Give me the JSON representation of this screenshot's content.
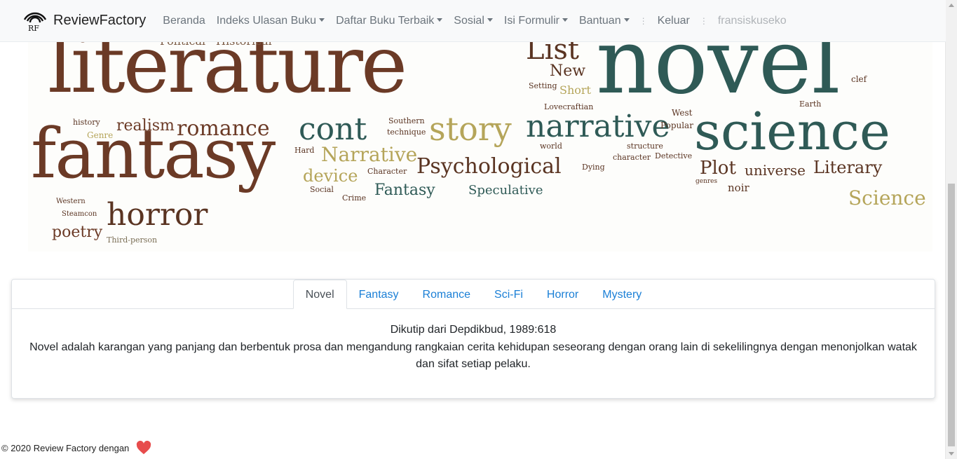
{
  "navbar": {
    "brand": "ReviewFactory",
    "logo_text": "RF",
    "items": [
      {
        "label": "Beranda",
        "dropdown": false
      },
      {
        "label": "Indeks Ulasan Buku",
        "dropdown": true
      },
      {
        "label": "Daftar Buku Terbaik",
        "dropdown": true
      },
      {
        "label": "Sosial",
        "dropdown": true
      },
      {
        "label": "Isi Formulir",
        "dropdown": true
      },
      {
        "label": "Bantuan",
        "dropdown": true
      }
    ],
    "separator": "⋮",
    "logout": "Keluar",
    "username": "fransiskuseko"
  },
  "banner": {
    "words": [
      "literature",
      "novel",
      "fantasy",
      "science",
      "narrative",
      "story",
      "cont",
      "romance",
      "realism",
      "horror",
      "poetry",
      "Psychological",
      "Narrative",
      "device",
      "Fantasy",
      "Speculative",
      "List",
      "New",
      "Short",
      "Setting",
      "Lovecraftian",
      "Plot",
      "universe",
      "Literary",
      "Science",
      "noir",
      "Popular",
      "West",
      "Earth",
      "clef",
      "Detective",
      "structure",
      "character",
      "world",
      "Dying",
      "genres",
      "Southern",
      "technique",
      "Character",
      "Social",
      "Crime",
      "Hard",
      "history",
      "Genre",
      "Western",
      "Steamcon",
      "Third-person",
      "Historical",
      "Political"
    ]
  },
  "tabs": {
    "items": [
      "Novel",
      "Fantasy",
      "Romance",
      "Sci-Fi",
      "Horror",
      "Mystery"
    ],
    "active": "Novel"
  },
  "content": {
    "source": "Dikutip dari Depdikbud, 1989:618",
    "text": "Novel adalah karangan yang panjang dan berbentuk prosa dan mengandung rangkaian cerita kehidupan seseorang dengan orang lain di sekelilingnya dengan menonjolkan watak dan sifat setiap pelaku."
  },
  "footer": {
    "text": "© 2020 Review Factory dengan"
  },
  "colors": {
    "navbar_bg": "#f8f9fa",
    "tab_link": "#1a7fd6",
    "cloud_brown": "#6b3a26",
    "cloud_teal": "#2f5a56",
    "cloud_olive": "#b5a55a",
    "heart": "#e74c4c"
  }
}
